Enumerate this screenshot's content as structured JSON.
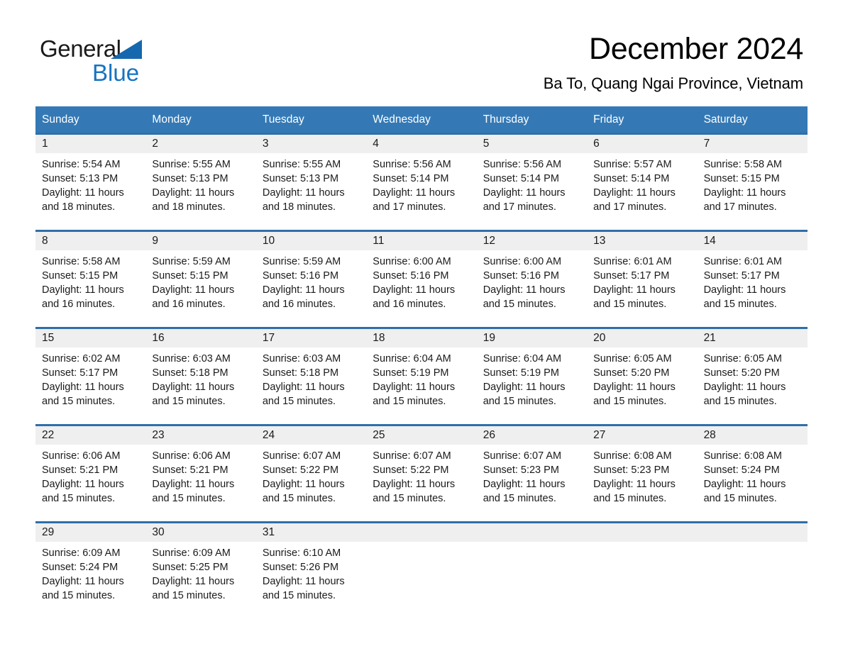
{
  "brand": {
    "name_part1": "General",
    "name_part2": "Blue",
    "triangle_color": "#1568ae",
    "blue_color": "#1673c0"
  },
  "header": {
    "title": "December 2024",
    "subtitle": "Ba To, Quang Ngai Province, Vietnam"
  },
  "theme": {
    "header_bar_color": "#3479b5",
    "row_divider_color": "#2f6fa8",
    "day_band_color": "#efefef"
  },
  "weekdays": [
    "Sunday",
    "Monday",
    "Tuesday",
    "Wednesday",
    "Thursday",
    "Friday",
    "Saturday"
  ],
  "weeks": [
    [
      {
        "day": "1",
        "sunrise": "Sunrise: 5:54 AM",
        "sunset": "Sunset: 5:13 PM",
        "daylight_line1": "Daylight: 11 hours",
        "daylight_line2": "and 18 minutes."
      },
      {
        "day": "2",
        "sunrise": "Sunrise: 5:55 AM",
        "sunset": "Sunset: 5:13 PM",
        "daylight_line1": "Daylight: 11 hours",
        "daylight_line2": "and 18 minutes."
      },
      {
        "day": "3",
        "sunrise": "Sunrise: 5:55 AM",
        "sunset": "Sunset: 5:13 PM",
        "daylight_line1": "Daylight: 11 hours",
        "daylight_line2": "and 18 minutes."
      },
      {
        "day": "4",
        "sunrise": "Sunrise: 5:56 AM",
        "sunset": "Sunset: 5:14 PM",
        "daylight_line1": "Daylight: 11 hours",
        "daylight_line2": "and 17 minutes."
      },
      {
        "day": "5",
        "sunrise": "Sunrise: 5:56 AM",
        "sunset": "Sunset: 5:14 PM",
        "daylight_line1": "Daylight: 11 hours",
        "daylight_line2": "and 17 minutes."
      },
      {
        "day": "6",
        "sunrise": "Sunrise: 5:57 AM",
        "sunset": "Sunset: 5:14 PM",
        "daylight_line1": "Daylight: 11 hours",
        "daylight_line2": "and 17 minutes."
      },
      {
        "day": "7",
        "sunrise": "Sunrise: 5:58 AM",
        "sunset": "Sunset: 5:15 PM",
        "daylight_line1": "Daylight: 11 hours",
        "daylight_line2": "and 17 minutes."
      }
    ],
    [
      {
        "day": "8",
        "sunrise": "Sunrise: 5:58 AM",
        "sunset": "Sunset: 5:15 PM",
        "daylight_line1": "Daylight: 11 hours",
        "daylight_line2": "and 16 minutes."
      },
      {
        "day": "9",
        "sunrise": "Sunrise: 5:59 AM",
        "sunset": "Sunset: 5:15 PM",
        "daylight_line1": "Daylight: 11 hours",
        "daylight_line2": "and 16 minutes."
      },
      {
        "day": "10",
        "sunrise": "Sunrise: 5:59 AM",
        "sunset": "Sunset: 5:16 PM",
        "daylight_line1": "Daylight: 11 hours",
        "daylight_line2": "and 16 minutes."
      },
      {
        "day": "11",
        "sunrise": "Sunrise: 6:00 AM",
        "sunset": "Sunset: 5:16 PM",
        "daylight_line1": "Daylight: 11 hours",
        "daylight_line2": "and 16 minutes."
      },
      {
        "day": "12",
        "sunrise": "Sunrise: 6:00 AM",
        "sunset": "Sunset: 5:16 PM",
        "daylight_line1": "Daylight: 11 hours",
        "daylight_line2": "and 15 minutes."
      },
      {
        "day": "13",
        "sunrise": "Sunrise: 6:01 AM",
        "sunset": "Sunset: 5:17 PM",
        "daylight_line1": "Daylight: 11 hours",
        "daylight_line2": "and 15 minutes."
      },
      {
        "day": "14",
        "sunrise": "Sunrise: 6:01 AM",
        "sunset": "Sunset: 5:17 PM",
        "daylight_line1": "Daylight: 11 hours",
        "daylight_line2": "and 15 minutes."
      }
    ],
    [
      {
        "day": "15",
        "sunrise": "Sunrise: 6:02 AM",
        "sunset": "Sunset: 5:17 PM",
        "daylight_line1": "Daylight: 11 hours",
        "daylight_line2": "and 15 minutes."
      },
      {
        "day": "16",
        "sunrise": "Sunrise: 6:03 AM",
        "sunset": "Sunset: 5:18 PM",
        "daylight_line1": "Daylight: 11 hours",
        "daylight_line2": "and 15 minutes."
      },
      {
        "day": "17",
        "sunrise": "Sunrise: 6:03 AM",
        "sunset": "Sunset: 5:18 PM",
        "daylight_line1": "Daylight: 11 hours",
        "daylight_line2": "and 15 minutes."
      },
      {
        "day": "18",
        "sunrise": "Sunrise: 6:04 AM",
        "sunset": "Sunset: 5:19 PM",
        "daylight_line1": "Daylight: 11 hours",
        "daylight_line2": "and 15 minutes."
      },
      {
        "day": "19",
        "sunrise": "Sunrise: 6:04 AM",
        "sunset": "Sunset: 5:19 PM",
        "daylight_line1": "Daylight: 11 hours",
        "daylight_line2": "and 15 minutes."
      },
      {
        "day": "20",
        "sunrise": "Sunrise: 6:05 AM",
        "sunset": "Sunset: 5:20 PM",
        "daylight_line1": "Daylight: 11 hours",
        "daylight_line2": "and 15 minutes."
      },
      {
        "day": "21",
        "sunrise": "Sunrise: 6:05 AM",
        "sunset": "Sunset: 5:20 PM",
        "daylight_line1": "Daylight: 11 hours",
        "daylight_line2": "and 15 minutes."
      }
    ],
    [
      {
        "day": "22",
        "sunrise": "Sunrise: 6:06 AM",
        "sunset": "Sunset: 5:21 PM",
        "daylight_line1": "Daylight: 11 hours",
        "daylight_line2": "and 15 minutes."
      },
      {
        "day": "23",
        "sunrise": "Sunrise: 6:06 AM",
        "sunset": "Sunset: 5:21 PM",
        "daylight_line1": "Daylight: 11 hours",
        "daylight_line2": "and 15 minutes."
      },
      {
        "day": "24",
        "sunrise": "Sunrise: 6:07 AM",
        "sunset": "Sunset: 5:22 PM",
        "daylight_line1": "Daylight: 11 hours",
        "daylight_line2": "and 15 minutes."
      },
      {
        "day": "25",
        "sunrise": "Sunrise: 6:07 AM",
        "sunset": "Sunset: 5:22 PM",
        "daylight_line1": "Daylight: 11 hours",
        "daylight_line2": "and 15 minutes."
      },
      {
        "day": "26",
        "sunrise": "Sunrise: 6:07 AM",
        "sunset": "Sunset: 5:23 PM",
        "daylight_line1": "Daylight: 11 hours",
        "daylight_line2": "and 15 minutes."
      },
      {
        "day": "27",
        "sunrise": "Sunrise: 6:08 AM",
        "sunset": "Sunset: 5:23 PM",
        "daylight_line1": "Daylight: 11 hours",
        "daylight_line2": "and 15 minutes."
      },
      {
        "day": "28",
        "sunrise": "Sunrise: 6:08 AM",
        "sunset": "Sunset: 5:24 PM",
        "daylight_line1": "Daylight: 11 hours",
        "daylight_line2": "and 15 minutes."
      }
    ],
    [
      {
        "day": "29",
        "sunrise": "Sunrise: 6:09 AM",
        "sunset": "Sunset: 5:24 PM",
        "daylight_line1": "Daylight: 11 hours",
        "daylight_line2": "and 15 minutes."
      },
      {
        "day": "30",
        "sunrise": "Sunrise: 6:09 AM",
        "sunset": "Sunset: 5:25 PM",
        "daylight_line1": "Daylight: 11 hours",
        "daylight_line2": "and 15 minutes."
      },
      {
        "day": "31",
        "sunrise": "Sunrise: 6:10 AM",
        "sunset": "Sunset: 5:26 PM",
        "daylight_line1": "Daylight: 11 hours",
        "daylight_line2": "and 15 minutes."
      },
      {
        "day": "",
        "sunrise": "",
        "sunset": "",
        "daylight_line1": "",
        "daylight_line2": ""
      },
      {
        "day": "",
        "sunrise": "",
        "sunset": "",
        "daylight_line1": "",
        "daylight_line2": ""
      },
      {
        "day": "",
        "sunrise": "",
        "sunset": "",
        "daylight_line1": "",
        "daylight_line2": ""
      },
      {
        "day": "",
        "sunrise": "",
        "sunset": "",
        "daylight_line1": "",
        "daylight_line2": ""
      }
    ]
  ]
}
